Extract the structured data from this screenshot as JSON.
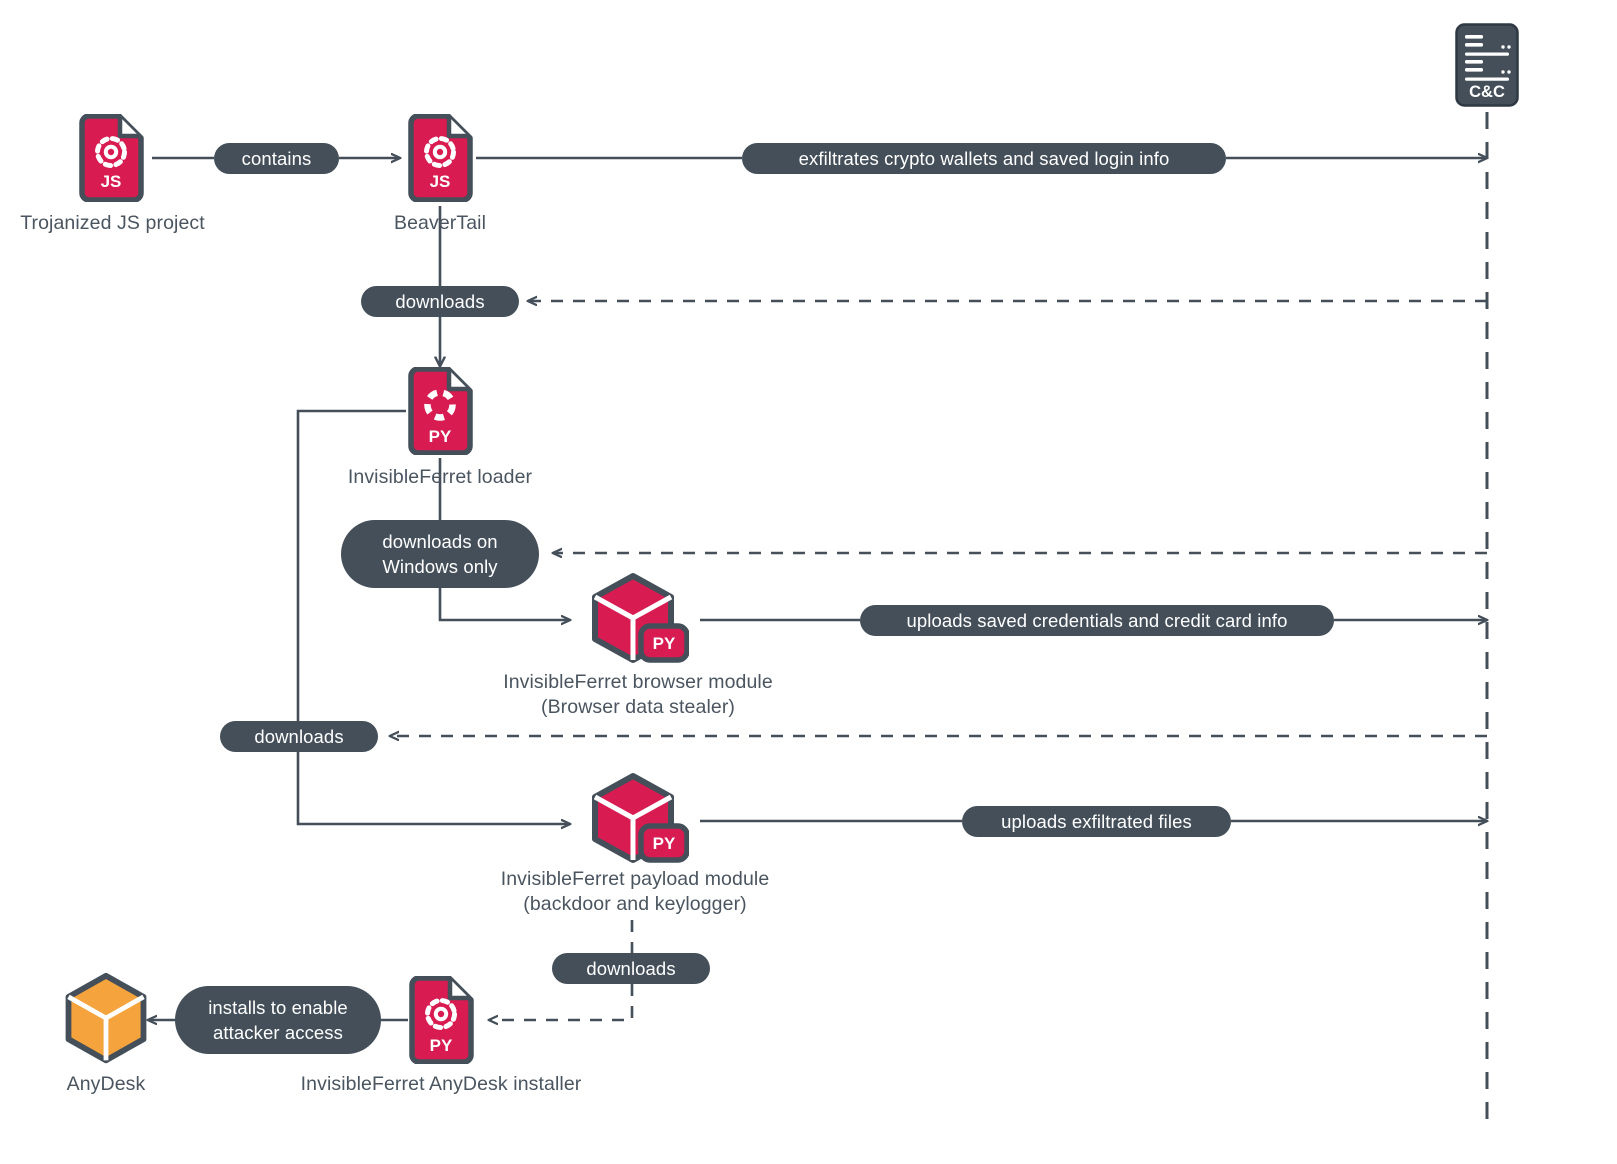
{
  "diagram": {
    "title": "BeaverTail / InvisibleFerret infection chain",
    "colors": {
      "malware_red": "#D81B51",
      "node_outline": "#444f5a",
      "pill_fill": "#444f5a",
      "pill_text": "#ffffff",
      "label_text": "#4a5560",
      "anydesk_orange": "#F5A33C",
      "line": "#444f5a",
      "background": "#ffffff"
    },
    "nodes": [
      {
        "id": "trojanized-js-project",
        "label": "Trojanized JS project",
        "icon": "js-file-gear-icon",
        "badge": "JS",
        "color": "#D81B51"
      },
      {
        "id": "beavertail",
        "label": "BeaverTail",
        "icon": "js-file-gear-icon",
        "badge": "JS",
        "color": "#D81B51"
      },
      {
        "id": "invisibleferret-loader",
        "label": "InvisibleFerret loader",
        "icon": "py-file-spinner-icon",
        "badge": "PY",
        "color": "#D81B51"
      },
      {
        "id": "invisibleferret-browser-module",
        "label": "InvisibleFerret browser module",
        "sublabel": "(Browser data stealer)",
        "icon": "py-cube-icon",
        "badge": "PY",
        "color": "#D81B51"
      },
      {
        "id": "invisibleferret-payload-module",
        "label": "InvisibleFerret payload module",
        "sublabel": "(backdoor and keylogger)",
        "icon": "py-cube-icon",
        "badge": "PY",
        "color": "#D81B51"
      },
      {
        "id": "invisibleferret-anydesk-installer",
        "label": "InvisibleFerret AnyDesk installer",
        "icon": "py-file-gear-icon",
        "badge": "PY",
        "color": "#D81B51"
      },
      {
        "id": "anydesk",
        "label": "AnyDesk",
        "icon": "cube-icon",
        "color": "#F5A33C"
      },
      {
        "id": "cnc-server",
        "label": "C&C",
        "icon": "server-icon",
        "color": "#444f5a"
      }
    ],
    "edges": [
      {
        "id": "e1",
        "from": "trojanized-js-project",
        "to": "beavertail",
        "label": "contains",
        "style": "solid"
      },
      {
        "id": "e2",
        "from": "beavertail",
        "to": "cnc-server",
        "label": "exfiltrates crypto wallets and saved login info",
        "style": "solid"
      },
      {
        "id": "e3",
        "from": "cnc-server",
        "to": "beavertail",
        "label": "downloads",
        "style": "dashed"
      },
      {
        "id": "e4",
        "from": "cnc-server",
        "to": "invisibleferret-browser-module",
        "label": "downloads on\nWindows only",
        "label_line1": "downloads on",
        "label_line2": "Windows only",
        "style": "dashed"
      },
      {
        "id": "e5",
        "from": "invisibleferret-browser-module",
        "to": "cnc-server",
        "label": "uploads saved credentials and credit card info",
        "style": "solid"
      },
      {
        "id": "e6",
        "from": "cnc-server",
        "to": "invisibleferret-payload-module",
        "label": "downloads",
        "style": "dashed"
      },
      {
        "id": "e7",
        "from": "invisibleferret-payload-module",
        "to": "cnc-server",
        "label": "uploads exfiltrated files",
        "style": "solid"
      },
      {
        "id": "e8",
        "from": "invisibleferret-payload-module",
        "to": "invisibleferret-anydesk-installer",
        "label": "downloads",
        "style": "dashed"
      },
      {
        "id": "e9",
        "from": "invisibleferret-anydesk-installer",
        "to": "anydesk",
        "label": "installs to enable\nattacker access",
        "label_line1": "installs to enable",
        "label_line2": "attacker access",
        "style": "solid"
      }
    ],
    "pills": {
      "contains": "contains",
      "exfiltrates": "exfiltrates crypto wallets and saved login info",
      "downloads_1": "downloads",
      "downloads_windows_l1": "downloads on",
      "downloads_windows_l2": "Windows only",
      "uploads_creds": "uploads saved credentials and credit card info",
      "downloads_2": "downloads",
      "uploads_files": "uploads exfiltrated files",
      "downloads_3": "downloads",
      "installs_l1": "installs to enable",
      "installs_l2": "attacker access"
    },
    "labels": {
      "trojanized": "Trojanized JS project",
      "beavertail": "BeaverTail",
      "loader": "InvisibleFerret loader",
      "browser_l1": "InvisibleFerret browser module",
      "browser_l2": "(Browser data stealer)",
      "payload_l1": "InvisibleFerret payload module",
      "payload_l2": "(backdoor and keylogger)",
      "anydesk_installer": "InvisibleFerret AnyDesk installer",
      "anydesk": "AnyDesk",
      "cnc": "C&C"
    },
    "badges": {
      "js": "JS",
      "py": "PY"
    }
  }
}
